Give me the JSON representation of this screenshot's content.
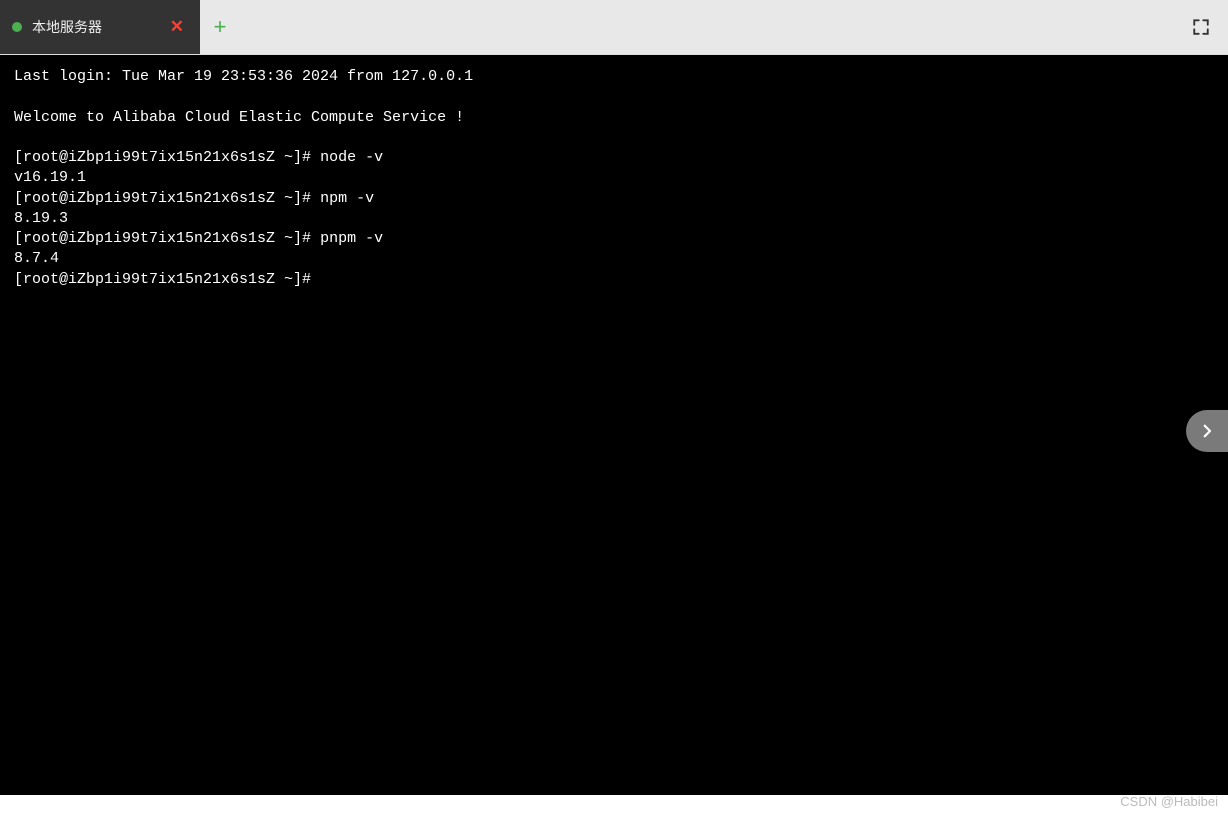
{
  "tab": {
    "label": "本地服务器"
  },
  "terminal": {
    "last_login": "Last login: Tue Mar 19 23:53:36 2024 from 127.0.0.1",
    "welcome": "Welcome to Alibaba Cloud Elastic Compute Service !",
    "prompt": "[root@iZbp1i99t7ix15n21x6s1sZ ~]#",
    "cmd1": "node -v",
    "out1": "v16.19.1",
    "cmd2": "npm -v",
    "out2": "8.19.3",
    "cmd3": "pnpm -v",
    "out3": "8.7.4"
  },
  "watermark": "CSDN @Habibei"
}
